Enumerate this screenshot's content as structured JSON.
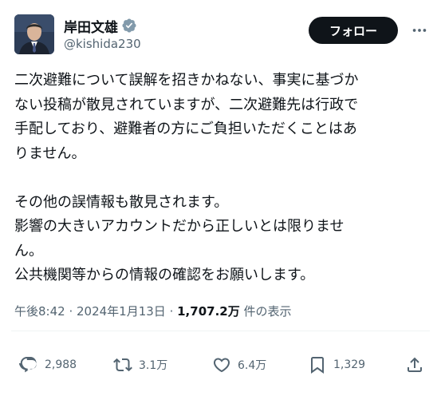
{
  "post": {
    "author": {
      "display_name": "岸田文雄",
      "handle": "@kishida230",
      "verified": true
    },
    "follow_label": "フォロー",
    "body_lines": [
      "二次避難について誤解を招きかねない、事実に基づか",
      "ない投稿が散見されていますが、二次避難先は行政で",
      "手配しており、避難者の方にご負担いただくことはあ",
      "りません。",
      "",
      "その他の誤情報も散見されます。",
      "影響の大きいアカウントだから正しいとは限りませ",
      "ん。",
      "公共機関等からの情報の確認をお願いします。"
    ],
    "time": "午後8:42",
    "separator": " · ",
    "date": "2024年1月13日",
    "views_count": "1,707.2万",
    "views_label": " 件の表示",
    "stats": {
      "replies": "2,988",
      "reposts": "3.1万",
      "likes": "6.4万",
      "bookmarks": "1,329"
    }
  },
  "colors": {
    "text_primary": "#0f1419",
    "text_secondary": "#536471",
    "verified_blue": "#1d9bf0",
    "follow_bg": "#0f1419"
  },
  "icons": [
    "verified-badge-icon",
    "more-icon",
    "reply-icon",
    "repost-icon",
    "like-icon",
    "bookmark-icon",
    "share-icon"
  ]
}
